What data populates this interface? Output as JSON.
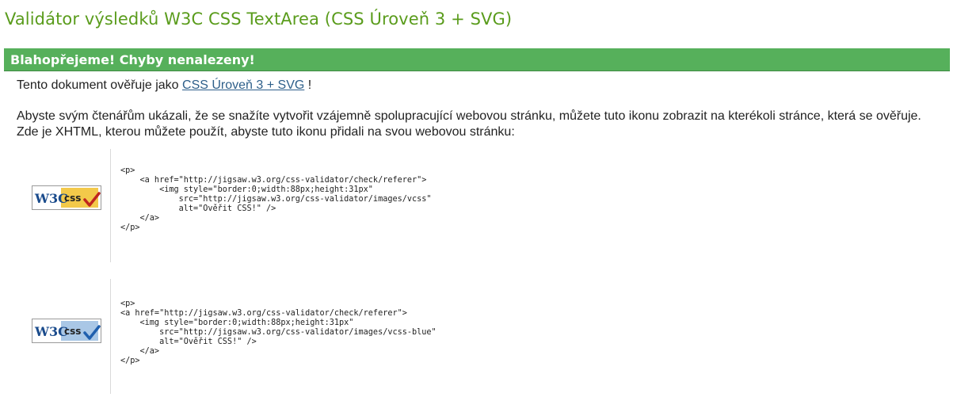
{
  "page": {
    "title": "Validátor výsledků W3C CSS TextArea (CSS Úroveň 3 + SVG)"
  },
  "banner": {
    "text": "Blahopřejeme! Chyby nenalezeny!"
  },
  "intro": {
    "prefix": "Tento dokument ověřuje jako ",
    "link_text": "CSS Úroveň 3 + SVG",
    "suffix": " !"
  },
  "explanation": {
    "line1": "Abyste svým čtenářům ukázali, že se snažíte vytvořit vzájemně spolupracující webovou stránku, můžete tuto ikonu zobrazit na kterékoli stránce, která se ověřuje.",
    "line2": "Zde je XHTML, kterou můžete použít, abyste tuto ikonu přidali na svou webovou stránku:"
  },
  "badges": [
    {
      "logo_text": "W3C",
      "badge_text": "css",
      "variant": "gold",
      "code": "<p>\n    <a href=\"http://jigsaw.w3.org/css-validator/check/referer\">\n        <img style=\"border:0;width:88px;height:31px\"\n            src=\"http://jigsaw.w3.org/css-validator/images/vcss\"\n            alt=\"Ověřit CSS!\" />\n    </a>\n</p>"
    },
    {
      "logo_text": "W3C",
      "badge_text": "css",
      "variant": "blue",
      "code": "<p>\n<a href=\"http://jigsaw.w3.org/css-validator/check/referer\">\n    <img style=\"border:0;width:88px;height:31px\"\n        src=\"http://jigsaw.w3.org/css-validator/images/vcss-blue\"\n        alt=\"Ověřit CSS!\" />\n    </a>\n</p>"
    }
  ],
  "colors": {
    "title_green": "#5a9c1c",
    "banner_green": "#56b05b",
    "link_blue": "#2e5f8a",
    "badge_gold": "#f3c94a",
    "badge_blue": "#a9c7e6",
    "check_red": "#c0251f",
    "check_blue": "#1f5fae",
    "w3c_blue": "#1a4b8c"
  }
}
